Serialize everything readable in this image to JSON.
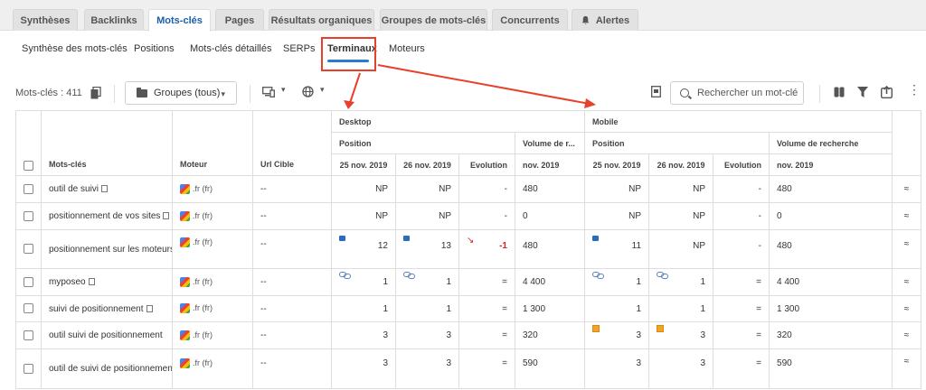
{
  "tabs": [
    {
      "label": "Synthèses",
      "active": false
    },
    {
      "label": "Backlinks",
      "active": false
    },
    {
      "label": "Mots-clés",
      "active": true
    },
    {
      "label": "Pages",
      "active": false
    },
    {
      "label": "Résultats organiques",
      "active": false
    },
    {
      "label": "Groupes de mots-clés",
      "active": false
    },
    {
      "label": "Concurrents",
      "active": false
    },
    {
      "label": "Alertes",
      "active": false,
      "icon": "bell-icon"
    }
  ],
  "subtabs": [
    {
      "label": "Synthèse des mots-clés"
    },
    {
      "label": "Positions"
    },
    {
      "label": "Mots-clés détaillés"
    },
    {
      "label": "SERPs"
    },
    {
      "label": "Terminaux",
      "active": true
    },
    {
      "label": "Moteurs"
    }
  ],
  "toolbar": {
    "count_label": "Mots-clés : 411",
    "groups_label": "Groupes (tous)",
    "search_placeholder": "Rechercher un mot-clé"
  },
  "table": {
    "header": {
      "keywords": "Mots-clés",
      "engine": "Moteur",
      "target_url": "Url Cible",
      "desktop": "Desktop",
      "mobile": "Mobile",
      "position": "Position",
      "volume_desktop": "Volume de r...",
      "volume_mobile": "Volume de recherche",
      "date1": "25 nov. 2019",
      "date2": "26 nov. 2019",
      "evolution": "Evolution",
      "month": "nov. 2019"
    },
    "rows": [
      {
        "keyword": "outil de suivi",
        "engine": ".fr (fr)",
        "url": "--",
        "d1": "NP",
        "d2": "NP",
        "devo": "-",
        "dvol": "480",
        "m1": "NP",
        "m2": "NP",
        "mevo": "-",
        "mvol": "480"
      },
      {
        "keyword": "positionnement de vos sites",
        "engine": ".fr (fr)",
        "url": "--",
        "d1": "NP",
        "d2": "NP",
        "devo": "-",
        "dvol": "0",
        "m1": "NP",
        "m2": "NP",
        "mevo": "-",
        "mvol": "0"
      },
      {
        "keyword": "positionnement sur les moteurs",
        "engine": ".fr (fr)",
        "url": "--",
        "d1": "12",
        "d2": "13",
        "devo": "-1",
        "dvol": "480",
        "m1": "11",
        "m2": "NP",
        "mevo": "-",
        "mvol": "480"
      },
      {
        "keyword": "myposeo",
        "engine": ".fr (fr)",
        "url": "--",
        "d1": "1",
        "d2": "1",
        "devo": "=",
        "dvol": "4 400",
        "m1": "1",
        "m2": "1",
        "mevo": "=",
        "mvol": "4 400"
      },
      {
        "keyword": "suivi de positionnement",
        "engine": ".fr (fr)",
        "url": "--",
        "d1": "1",
        "d2": "1",
        "devo": "=",
        "dvol": "1 300",
        "m1": "1",
        "m2": "1",
        "mevo": "=",
        "mvol": "1 300"
      },
      {
        "keyword": "outil suivi de positionnement",
        "engine": ".fr (fr)",
        "url": "--",
        "d1": "3",
        "d2": "3",
        "devo": "=",
        "dvol": "320",
        "m1": "3",
        "m2": "3",
        "mevo": "=",
        "mvol": "320"
      },
      {
        "keyword": "outil de suivi de positionnement",
        "engine": ".fr (fr)",
        "url": "--",
        "d1": "3",
        "d2": "3",
        "devo": "=",
        "dvol": "590",
        "m1": "3",
        "m2": "3",
        "mevo": "=",
        "mvol": "590"
      }
    ]
  },
  "colors": {
    "accent": "#2a7ccf",
    "annotation": "#e8402a",
    "negative": "#dd2222"
  }
}
